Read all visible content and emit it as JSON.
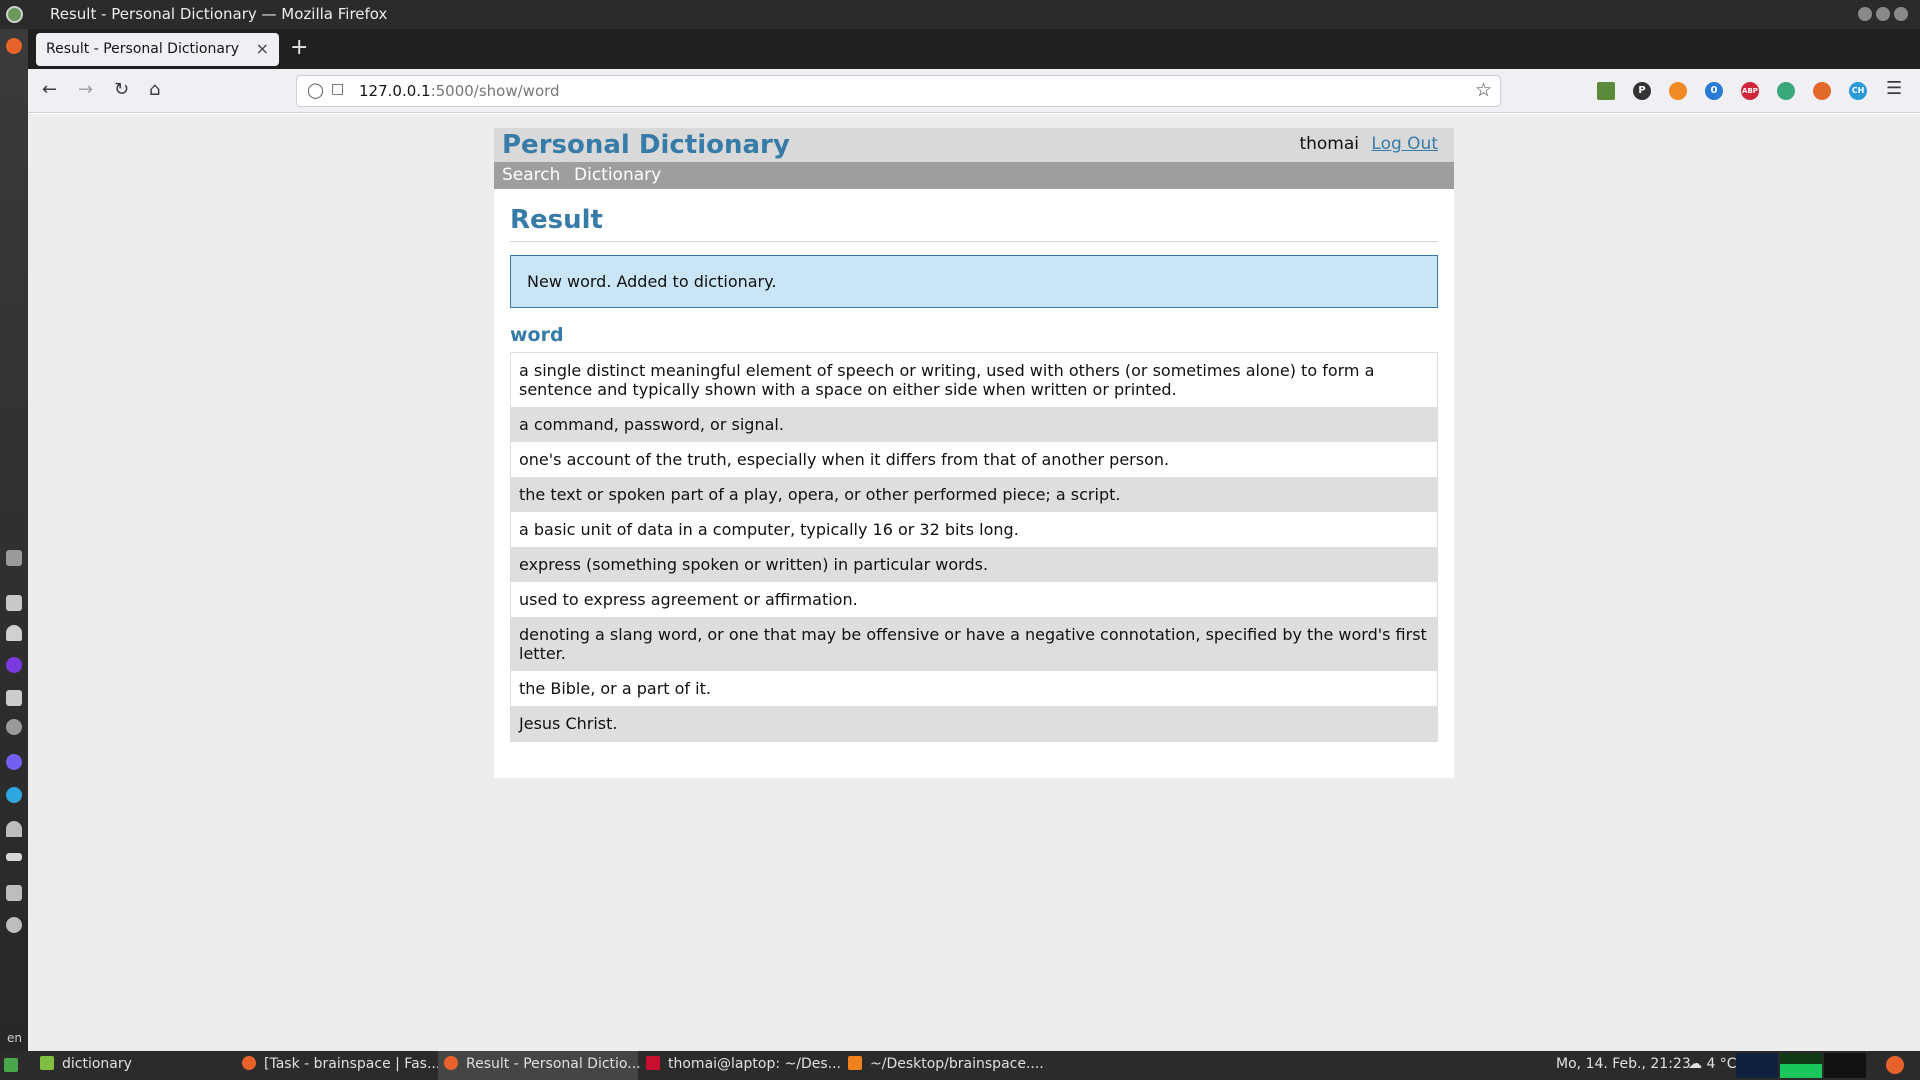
{
  "window": {
    "title": "Result - Personal Dictionary — Mozilla Firefox"
  },
  "browser": {
    "tab_title": "Result - Personal Dictionary",
    "tab_close": "×",
    "new_tab": "+",
    "url_host": "127.0.0.1",
    "url_path": ":5000/show/word",
    "extensions": [
      {
        "icon": "download-icon",
        "color": "#5a8a3a"
      },
      {
        "icon": "p-extension-icon",
        "color": "#333333",
        "label": "P"
      },
      {
        "icon": "orange-extension-icon",
        "color": "#f08a24"
      },
      {
        "icon": "notification-extension-icon",
        "color": "#2a7ad8",
        "badge": "0"
      },
      {
        "icon": "adblock-icon",
        "color": "#d0263a",
        "label": "ABP"
      },
      {
        "icon": "green-extension-icon",
        "color": "#3aa87a"
      },
      {
        "icon": "duckduckgo-icon",
        "color": "#e36a2a"
      },
      {
        "icon": "ch-extension-icon",
        "color": "#2a9ad8",
        "badge": "CH"
      }
    ]
  },
  "app": {
    "brand": "Personal Dictionary",
    "username": "thomai",
    "logout": "Log Out",
    "nav": {
      "search": "Search",
      "dictionary": "Dictionary"
    },
    "page_title": "Result",
    "flash": "New word. Added to dictionary.",
    "word": "word",
    "definitions": [
      "a single distinct meaningful element of speech or writing, used with others (or sometimes alone) to form a sentence and typically shown with a space on either side when written or printed.",
      "a command, password, or signal.",
      "one's account of the truth, especially when it differs from that of another person.",
      "the text or spoken part of a play, opera, or other performed piece; a script.",
      "a basic unit of data in a computer, typically 16 or 32 bits long.",
      "express (something spoken or written) in particular words.",
      "used to express agreement or affirmation.",
      "denoting a slang word, or one that may be offensive or have a negative connotation, specified by the word's first letter.",
      "the Bible, or a part of it.",
      "Jesus Christ."
    ]
  },
  "dock": {
    "lang": "en"
  },
  "taskbar": {
    "items": [
      {
        "label": "dictionary",
        "icon": "folder-icon",
        "color": "#7fbf3f"
      },
      {
        "label": "[Task - brainspace | Fas...",
        "icon": "firefox-icon",
        "color": "#e8632b"
      },
      {
        "label": "Result - Personal Dictio...",
        "icon": "firefox-icon",
        "color": "#e8632b"
      },
      {
        "label": "thomai@laptop: ~/Des...",
        "icon": "terminal-icon",
        "color": "#c8102e"
      },
      {
        "label": "~/Desktop/brainspace....",
        "icon": "sublime-icon",
        "color": "#f0821e"
      }
    ],
    "clock": "Mo, 14. Feb., 21:23",
    "weather": "4 °C"
  }
}
